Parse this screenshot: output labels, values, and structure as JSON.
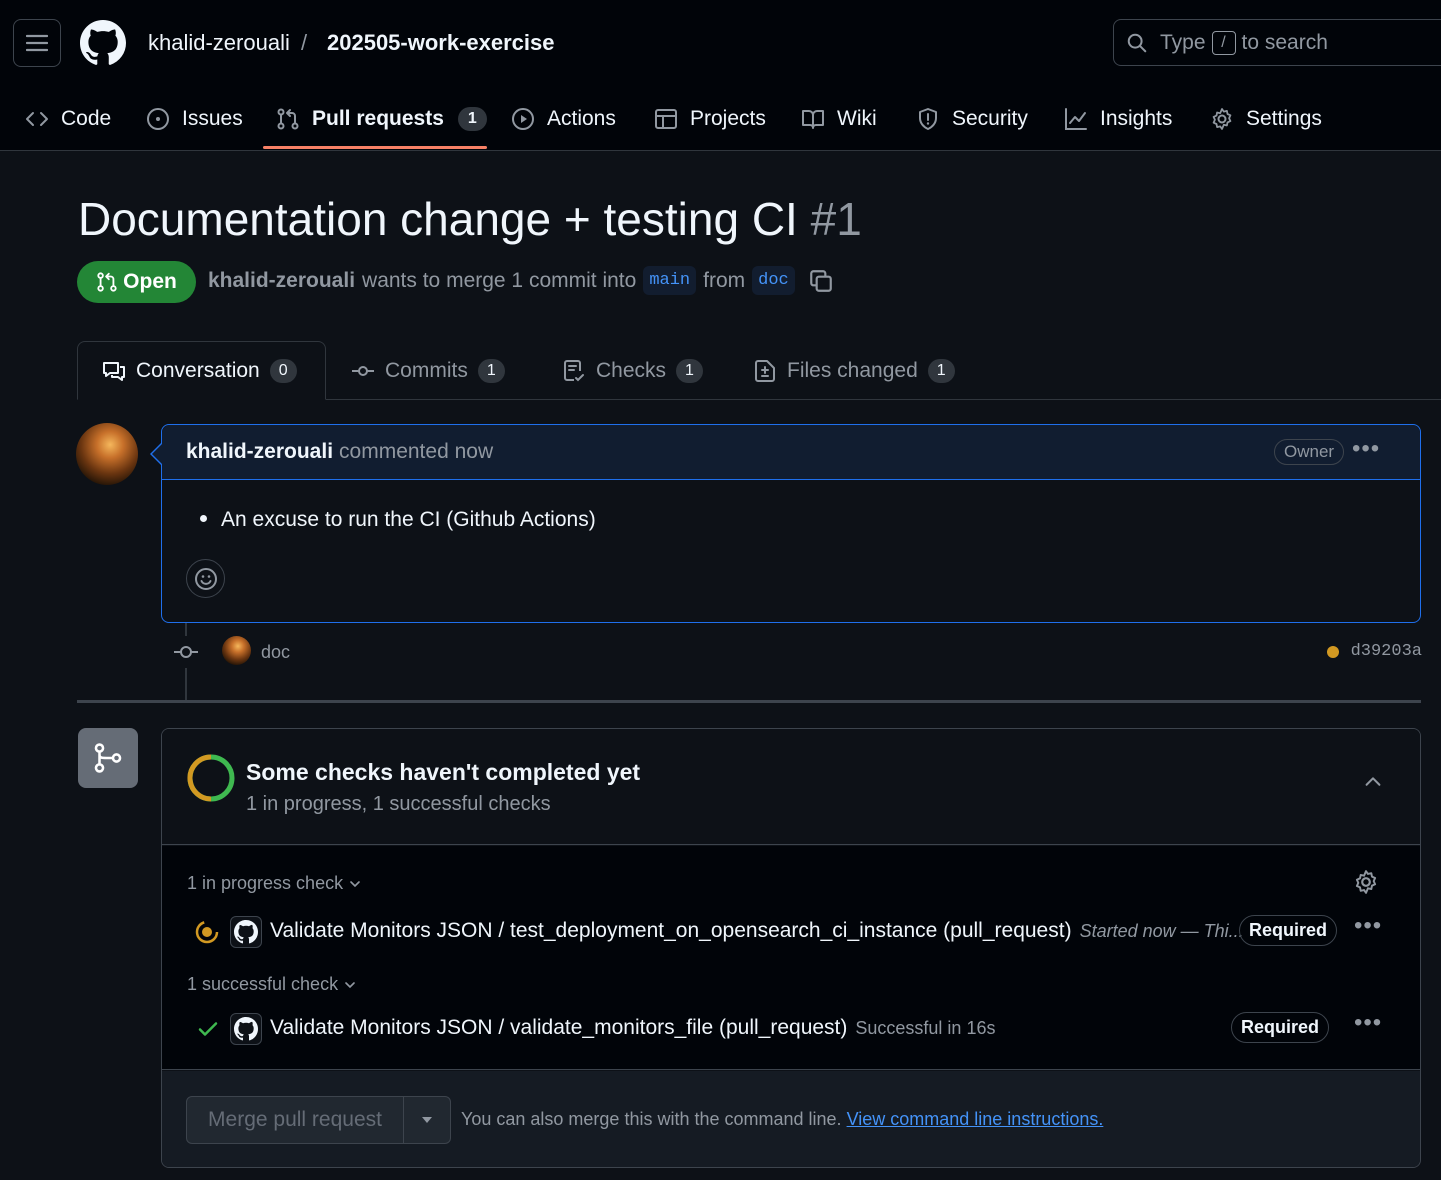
{
  "header": {
    "owner": "khalid-zerouali",
    "separator": "/",
    "repo": "202505-work-exercise",
    "search": {
      "before": "Type",
      "key": "/",
      "after": "to search"
    }
  },
  "nav": {
    "code": "Code",
    "issues": "Issues",
    "pulls": "Pull requests",
    "pulls_count": "1",
    "actions": "Actions",
    "projects": "Projects",
    "wiki": "Wiki",
    "security": "Security",
    "insights": "Insights",
    "settings": "Settings"
  },
  "pr": {
    "title": "Documentation change + testing CI",
    "number": "#1",
    "state": "Open",
    "author": "khalid-zerouali",
    "merge_text": "wants to merge 1 commit into",
    "base": "main",
    "from_text": "from",
    "head": "doc"
  },
  "tabs": {
    "conversation": "Conversation",
    "conversation_count": "0",
    "commits": "Commits",
    "commits_count": "1",
    "checks": "Checks",
    "checks_count": "1",
    "files": "Files changed",
    "files_count": "1"
  },
  "comment": {
    "author": "khalid-zerouali",
    "time": "commented now",
    "role": "Owner",
    "bullet": "An excuse to run the CI (Github Actions)"
  },
  "commit": {
    "name": "doc",
    "sha": "d39203a",
    "status_color": "#d29922"
  },
  "checks": {
    "title": "Some checks haven't completed yet",
    "subtitle": "1 in progress, 1 successful checks",
    "in_progress_label": "1 in progress check",
    "in_progress_item": "Validate Monitors JSON / test_deployment_on_opensearch_ci_instance (pull_request)",
    "in_progress_meta": "Started now — Thi...",
    "success_label": "1 successful check",
    "success_item": "Validate Monitors JSON / validate_monitors_file (pull_request)",
    "success_meta": "Successful in 16s",
    "required": "Required"
  },
  "merge": {
    "button": "Merge pull request",
    "note": "You can also merge this with the command line.",
    "link": "View command line instructions."
  },
  "colors": {
    "accent": "#f78166",
    "open": "#238636",
    "link": "#4493f8",
    "pending": "#d29922",
    "success": "#3fb950"
  }
}
